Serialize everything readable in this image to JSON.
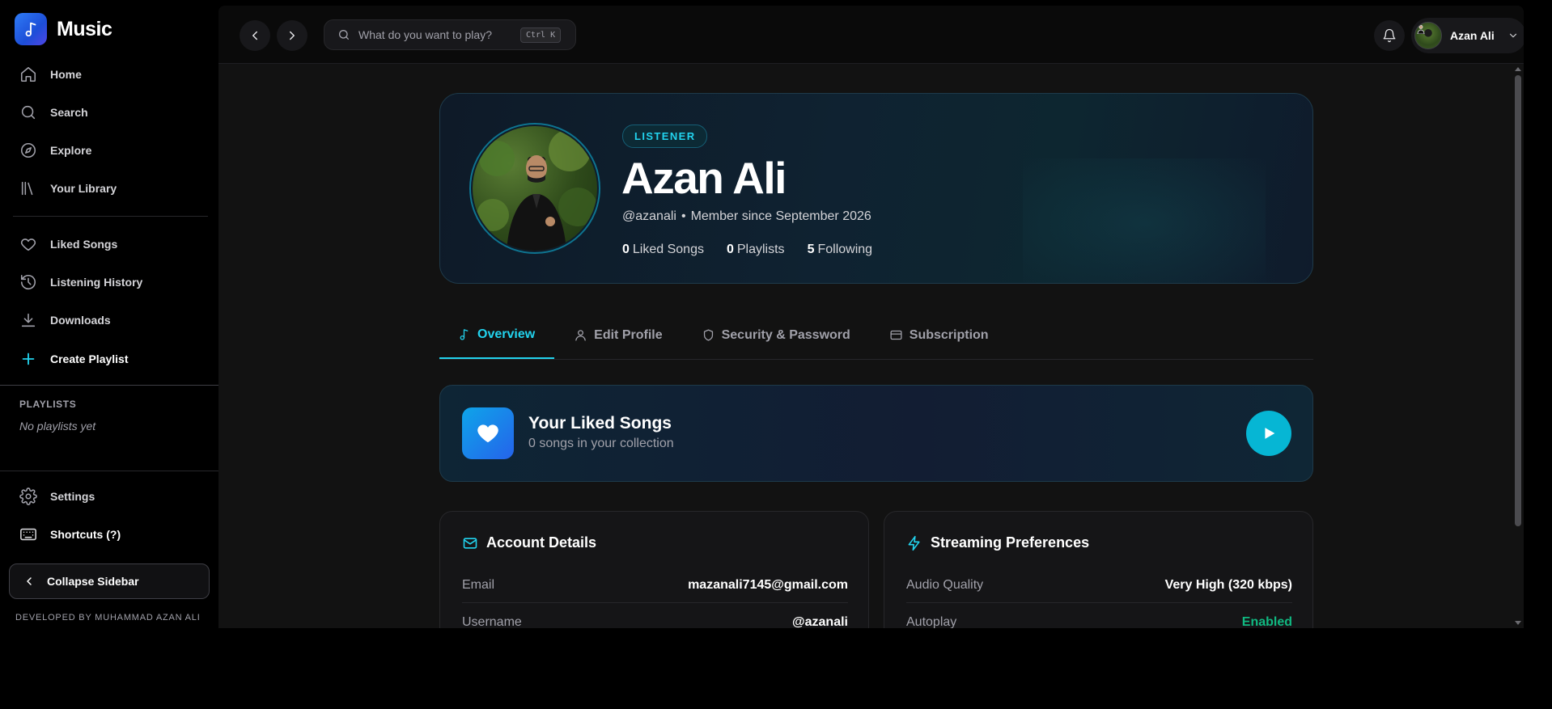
{
  "app": {
    "name": "Music"
  },
  "sidebar": {
    "nav": [
      {
        "label": "Home",
        "icon": "home-icon"
      },
      {
        "label": "Search",
        "icon": "search-icon"
      },
      {
        "label": "Explore",
        "icon": "compass-icon"
      },
      {
        "label": "Your Library",
        "icon": "library-icon"
      }
    ],
    "library": [
      {
        "label": "Liked Songs",
        "icon": "heart-icon"
      },
      {
        "label": "Listening History",
        "icon": "history-icon"
      },
      {
        "label": "Downloads",
        "icon": "download-icon"
      },
      {
        "label": "Create Playlist",
        "icon": "plus-icon"
      }
    ],
    "playlists_heading": "PLAYLISTS",
    "playlists_empty": "No playlists yet",
    "settings_label": "Settings",
    "shortcuts_label": "Shortcuts (?)",
    "collapse_label": "Collapse Sidebar",
    "credit": "DEVELOPED BY MUHAMMAD AZAN ALI"
  },
  "topbar": {
    "search_placeholder": "What do you want to play?",
    "search_shortcut": "Ctrl K",
    "user_name": "Azan Ali"
  },
  "profile": {
    "role": "LISTENER",
    "name": "Azan Ali",
    "handle": "@azanali",
    "separator": "•",
    "member_since": "Member since September 2026",
    "stats": [
      {
        "value": "0",
        "label": "Liked Songs"
      },
      {
        "value": "0",
        "label": "Playlists"
      },
      {
        "value": "5",
        "label": "Following"
      }
    ]
  },
  "tabs": [
    {
      "label": "Overview",
      "active": true
    },
    {
      "label": "Edit Profile",
      "active": false
    },
    {
      "label": "Security & Password",
      "active": false
    },
    {
      "label": "Subscription",
      "active": false
    }
  ],
  "liked_banner": {
    "title": "Your Liked Songs",
    "subtitle": "0 songs in your collection"
  },
  "account_details": {
    "title": "Account Details",
    "rows": [
      {
        "key": "Email",
        "value": "mazanali7145@gmail.com"
      },
      {
        "key": "Username",
        "value": "@azanali"
      }
    ]
  },
  "streaming_prefs": {
    "title": "Streaming Preferences",
    "rows": [
      {
        "key": "Audio Quality",
        "value": "Very High (320 kbps)"
      },
      {
        "key": "Autoplay",
        "value": "Enabled"
      }
    ]
  },
  "colors": {
    "accent": "#22d3ee",
    "brand": "#2563eb",
    "enabled": "#10b981",
    "background": "#121212"
  }
}
